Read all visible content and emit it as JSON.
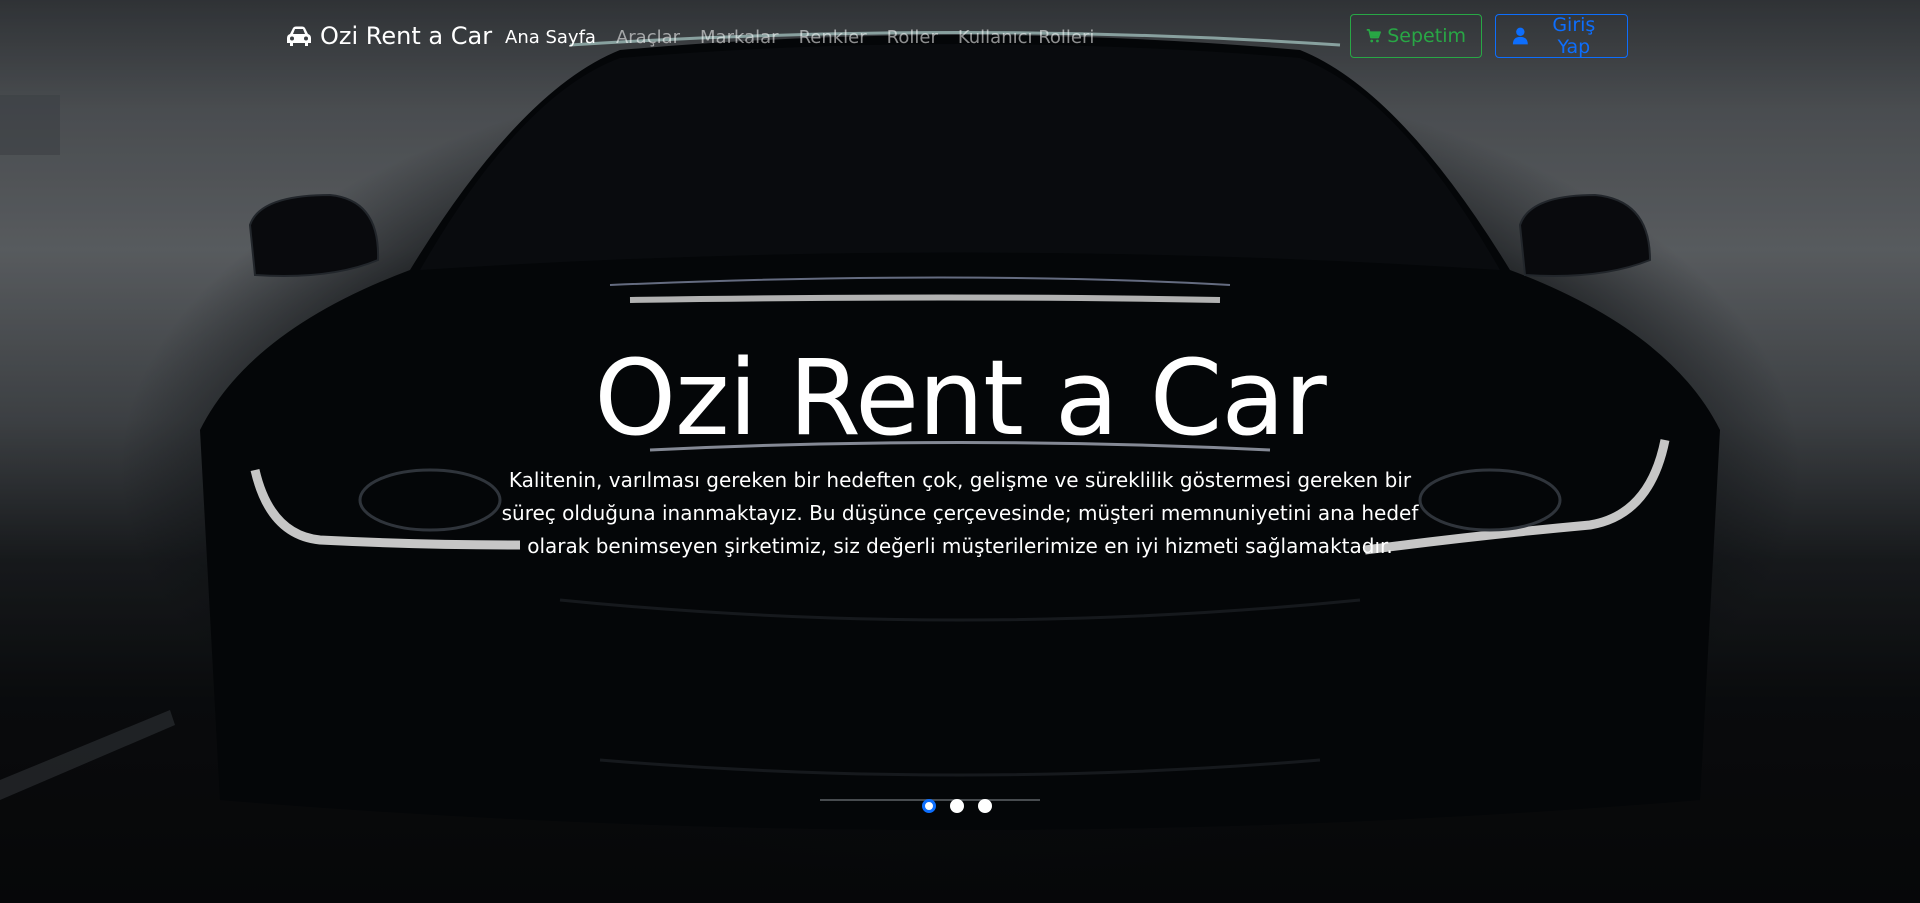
{
  "navbar": {
    "brand": "Ozi Rent a Car",
    "brand_icon": "car-icon",
    "links": [
      {
        "label": "Ana Sayfa",
        "active": true
      },
      {
        "label": "Araçlar",
        "active": false
      },
      {
        "label": "Markalar",
        "active": false
      },
      {
        "label": "Renkler",
        "active": false
      },
      {
        "label": "Roller",
        "active": false
      },
      {
        "label": "Kullanıcı Rolleri",
        "active": false
      }
    ],
    "cart_button": {
      "label": "Sepetim",
      "icon": "shopping-cart-icon",
      "color": "#28a745"
    },
    "login_button": {
      "label": "Giriş Yap",
      "icon": "user-icon",
      "color": "#0d6efd"
    }
  },
  "carousel": {
    "title": "Ozi Rent a Car",
    "text": "Kalitenin, varılması gereken bir hedeften çok, gelişme ve süreklilik göstermesi gereken bir süreç olduğuna inanmaktayız. Bu düşünce çerçevesinde; müşteri memnuniyetini ana hedef olarak benimseyen şirketimiz, siz değerli müşterilerimize en iyi hizmeti sağlamaktadır.",
    "slide_count": 3,
    "active_slide": 1
  }
}
